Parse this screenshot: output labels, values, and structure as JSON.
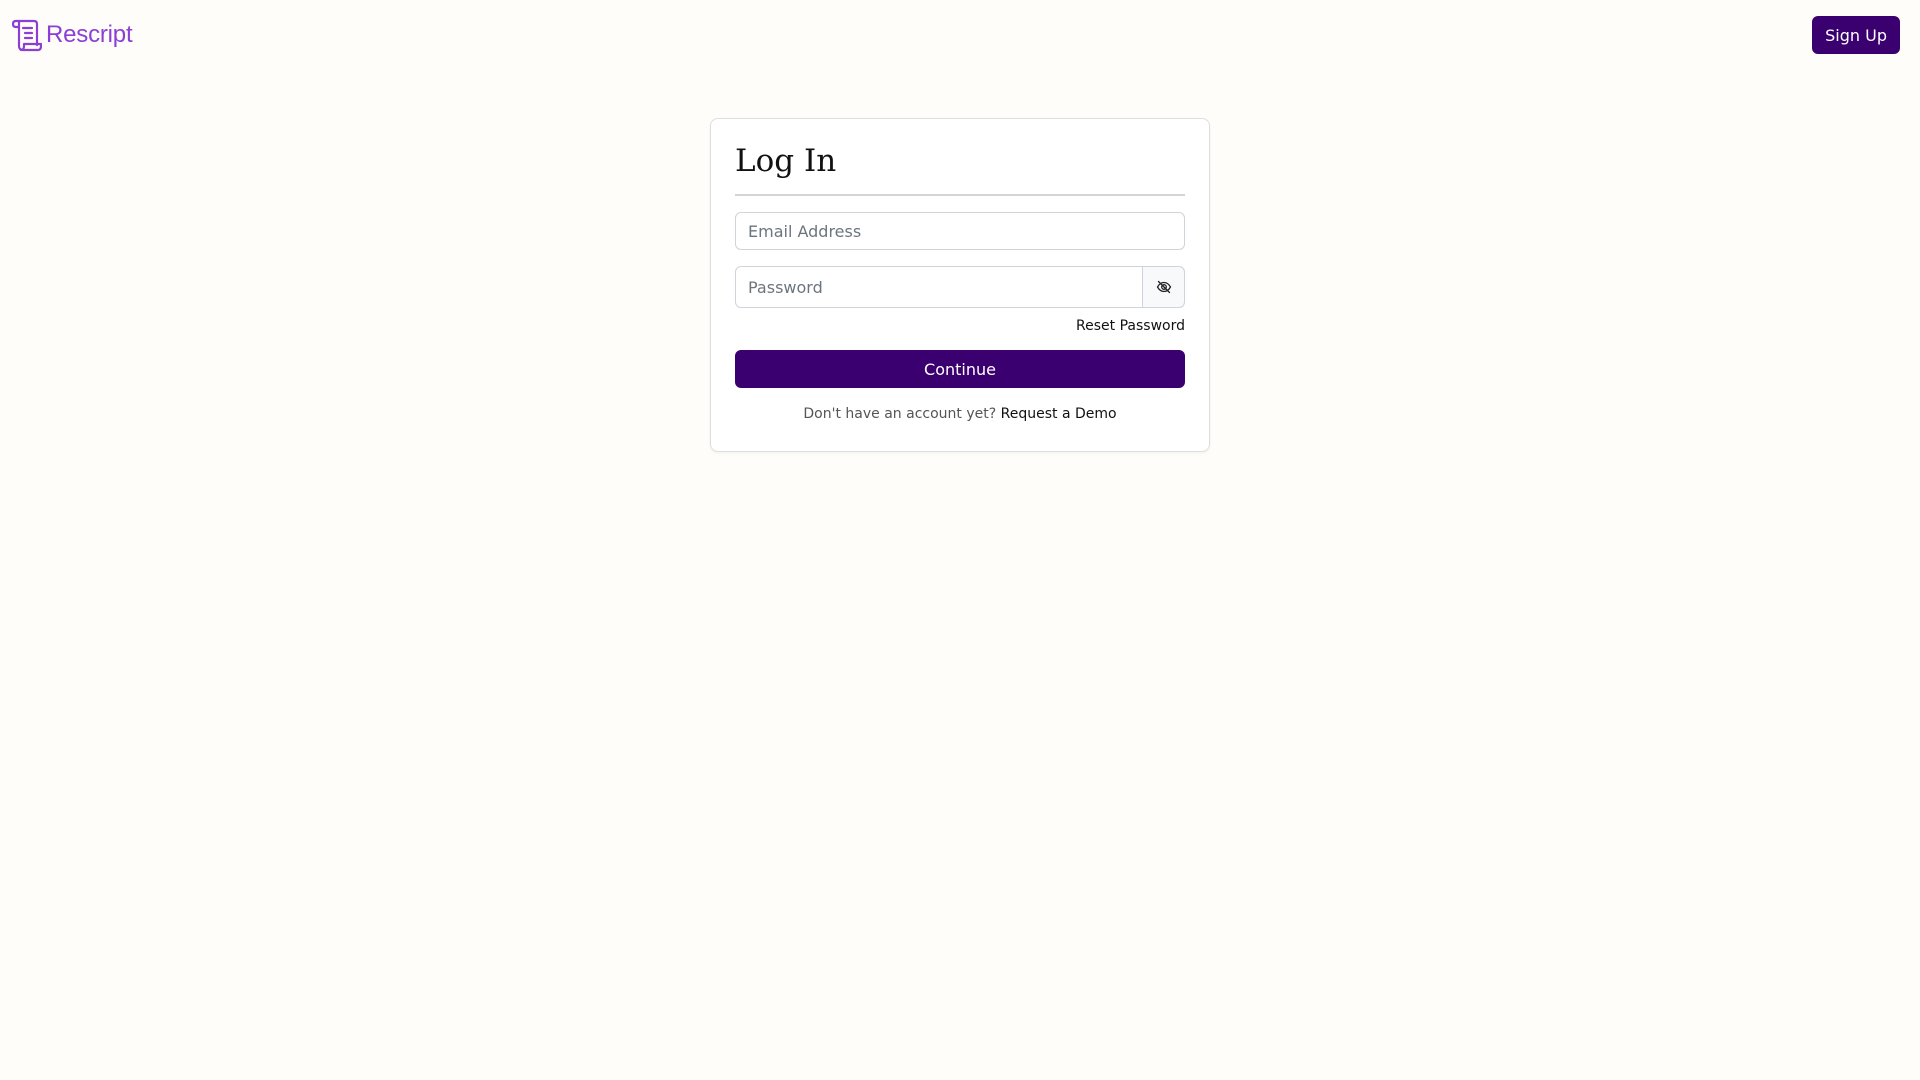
{
  "brand": {
    "name": "Rescript",
    "icon": "scroll-icon",
    "color": "#8b3fd6"
  },
  "header": {
    "signup_label": "Sign Up"
  },
  "login": {
    "title": "Log In",
    "email_placeholder": "Email Address",
    "email_value": "",
    "password_placeholder": "Password",
    "password_value": "",
    "password_toggle_icon": "eye-slash-icon",
    "reset_label": "Reset Password",
    "continue_label": "Continue",
    "no_account_text": "Don't have an account yet?",
    "demo_label": "Request a Demo"
  },
  "colors": {
    "primary": "#3b0070",
    "background": "#fffdf9"
  }
}
